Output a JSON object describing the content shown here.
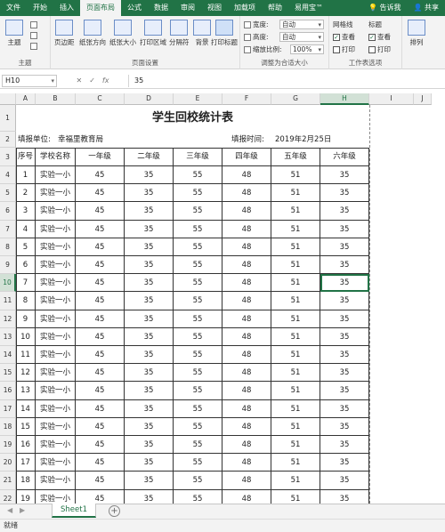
{
  "tabs": [
    "文件",
    "开始",
    "插入",
    "页面布局",
    "公式",
    "数据",
    "审阅",
    "视图",
    "加载项",
    "帮助",
    "易用宝™"
  ],
  "tell_me": "告诉我",
  "share": "共享",
  "ribbon": {
    "themes": {
      "label": "主题",
      "group": "主题"
    },
    "page_setup": {
      "margins": "页边距",
      "orientation": "纸张方向",
      "size": "纸张大小",
      "print_area": "打印区域",
      "breaks": "分隔符",
      "background": "背景",
      "print_titles": "打印标题",
      "group": "页面设置"
    },
    "scale": {
      "width_label": "宽度:",
      "width_value": "自动",
      "height_label": "高度:",
      "height_value": "自动",
      "scale_label": "缩放比例:",
      "scale_value": "100%",
      "group": "调整为合适大小"
    },
    "sheet_options": {
      "gridlines": "网格线",
      "headings": "标题",
      "view": "查看",
      "print": "打印",
      "group": "工作表选项"
    },
    "arrange": {
      "label": "排列"
    }
  },
  "formula_bar": {
    "cell_ref": "H10",
    "fx": "fx",
    "value": "35"
  },
  "columns": [
    "A",
    "B",
    "C",
    "D",
    "E",
    "F",
    "G",
    "H",
    "I",
    "J"
  ],
  "rows": [
    "1",
    "2",
    "3",
    "4",
    "5",
    "6",
    "7",
    "8",
    "9",
    "10",
    "11",
    "12",
    "13",
    "14",
    "15",
    "16",
    "17",
    "18",
    "19",
    "20",
    "21",
    "22"
  ],
  "sheet": {
    "title": "学生回校统计表",
    "unit_label": "填报单位:",
    "unit_value": "幸福里教育局",
    "time_label": "填报时间:",
    "time_value": "2019年2月25日",
    "headers": [
      "序号",
      "学校名称",
      "一年级",
      "二年级",
      "三年级",
      "四年级",
      "五年级",
      "六年级"
    ],
    "data_rows": [
      [
        "1",
        "实验一小",
        "45",
        "35",
        "55",
        "48",
        "51",
        "35"
      ],
      [
        "2",
        "实验一小",
        "45",
        "35",
        "55",
        "48",
        "51",
        "35"
      ],
      [
        "3",
        "实验一小",
        "45",
        "35",
        "55",
        "48",
        "51",
        "35"
      ],
      [
        "4",
        "实验一小",
        "45",
        "35",
        "55",
        "48",
        "51",
        "35"
      ],
      [
        "5",
        "实验一小",
        "45",
        "35",
        "55",
        "48",
        "51",
        "35"
      ],
      [
        "6",
        "实验一小",
        "45",
        "35",
        "55",
        "48",
        "51",
        "35"
      ],
      [
        "7",
        "实验一小",
        "45",
        "35",
        "55",
        "48",
        "51",
        "35"
      ],
      [
        "8",
        "实验一小",
        "45",
        "35",
        "55",
        "48",
        "51",
        "35"
      ],
      [
        "9",
        "实验一小",
        "45",
        "35",
        "55",
        "48",
        "51",
        "35"
      ],
      [
        "10",
        "实验一小",
        "45",
        "35",
        "55",
        "48",
        "51",
        "35"
      ],
      [
        "11",
        "实验一小",
        "45",
        "35",
        "55",
        "48",
        "51",
        "35"
      ],
      [
        "12",
        "实验一小",
        "45",
        "35",
        "55",
        "48",
        "51",
        "35"
      ],
      [
        "13",
        "实验一小",
        "45",
        "35",
        "55",
        "48",
        "51",
        "35"
      ],
      [
        "14",
        "实验一小",
        "45",
        "35",
        "55",
        "48",
        "51",
        "35"
      ],
      [
        "15",
        "实验一小",
        "45",
        "35",
        "55",
        "48",
        "51",
        "35"
      ],
      [
        "16",
        "实验一小",
        "45",
        "35",
        "55",
        "48",
        "51",
        "35"
      ],
      [
        "17",
        "实验一小",
        "45",
        "35",
        "55",
        "48",
        "51",
        "35"
      ],
      [
        "18",
        "实验一小",
        "45",
        "35",
        "55",
        "48",
        "51",
        "35"
      ],
      [
        "19",
        "实验一小",
        "45",
        "35",
        "55",
        "48",
        "51",
        "35"
      ]
    ]
  },
  "sheet_tab": "Sheet1",
  "add_sheet_icon": "plus-icon",
  "status": "就绪",
  "colors": {
    "accent": "#217346"
  }
}
